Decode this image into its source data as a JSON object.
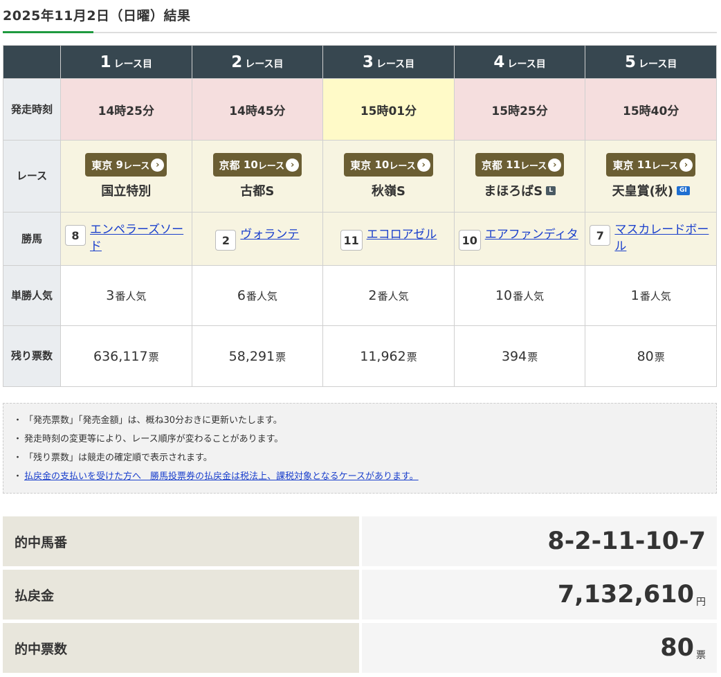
{
  "heading": "2025年11月2日（日曜）結果",
  "races": [
    {
      "num": "1",
      "suffix": "レース目",
      "time": "14時25分",
      "venue": "東京",
      "race_no": "9",
      "race_suffix": "レース",
      "name": "国立特別",
      "grade": "",
      "horse_num": "8",
      "horse_name": "エンペラーズソード",
      "popularity": "3",
      "pop_unit": "番人気",
      "remaining": "636,117",
      "remain_unit": "票"
    },
    {
      "num": "2",
      "suffix": "レース目",
      "time": "14時45分",
      "venue": "京都",
      "race_no": "10",
      "race_suffix": "レース",
      "name": "古都S",
      "grade": "",
      "horse_num": "2",
      "horse_name": "ヴォランテ",
      "popularity": "6",
      "pop_unit": "番人気",
      "remaining": "58,291",
      "remain_unit": "票"
    },
    {
      "num": "3",
      "suffix": "レース目",
      "time": "15時01分",
      "venue": "東京",
      "race_no": "10",
      "race_suffix": "レース",
      "name": "秋嶺S",
      "grade": "",
      "horse_num": "11",
      "horse_name": "エコロアゼル",
      "popularity": "2",
      "pop_unit": "番人気",
      "remaining": "11,962",
      "remain_unit": "票"
    },
    {
      "num": "4",
      "suffix": "レース目",
      "time": "15時25分",
      "venue": "京都",
      "race_no": "11",
      "race_suffix": "レース",
      "name": "まほろばS",
      "grade": "L",
      "horse_num": "10",
      "horse_name": "エアファンディタ",
      "popularity": "10",
      "pop_unit": "番人気",
      "remaining": "394",
      "remain_unit": "票"
    },
    {
      "num": "5",
      "suffix": "レース目",
      "time": "15時40分",
      "venue": "東京",
      "race_no": "11",
      "race_suffix": "レース",
      "name": "天皇賞(秋)",
      "grade": "GI",
      "horse_num": "7",
      "horse_name": "マスカレードボール",
      "popularity": "1",
      "pop_unit": "番人気",
      "remaining": "80",
      "remain_unit": "票"
    }
  ],
  "row_labels": {
    "start_time": "発走時刻",
    "race": "レース",
    "winner": "勝馬",
    "popularity": "単勝人気",
    "remaining": "残り票数"
  },
  "arrow_glyph": "›",
  "notes": [
    {
      "text": "「発売票数」「発売金額」は、概ね30分おきに更新いたします。",
      "link": false
    },
    {
      "text": "発走時刻の変更等により、レース順序が変わることがあります。",
      "link": false
    },
    {
      "text": "「残り票数」は競走の確定順で表示されます。",
      "link": false
    },
    {
      "text": "払戻金の支払いを受けた方へ　勝馬投票券の払戻金は税法上、課税対象となるケースがあります。",
      "link": true
    }
  ],
  "note_bullet": "・",
  "summary": [
    {
      "label": "的中馬番",
      "value": "8-2-11-10-7",
      "unit": ""
    },
    {
      "label": "払戻金",
      "value": "7,132,610",
      "unit": "円"
    },
    {
      "label": "的中票数",
      "value": "80",
      "unit": "票"
    }
  ],
  "colors": {
    "header_bg": "#374750",
    "time_bg": "#f5dede",
    "time_highlight_bg": "#fffac8",
    "race_bg": "#f7f4e1",
    "venue_btn": "#6b5e33",
    "link": "#1a3fcc",
    "accent_green": "#1e9a3e"
  }
}
